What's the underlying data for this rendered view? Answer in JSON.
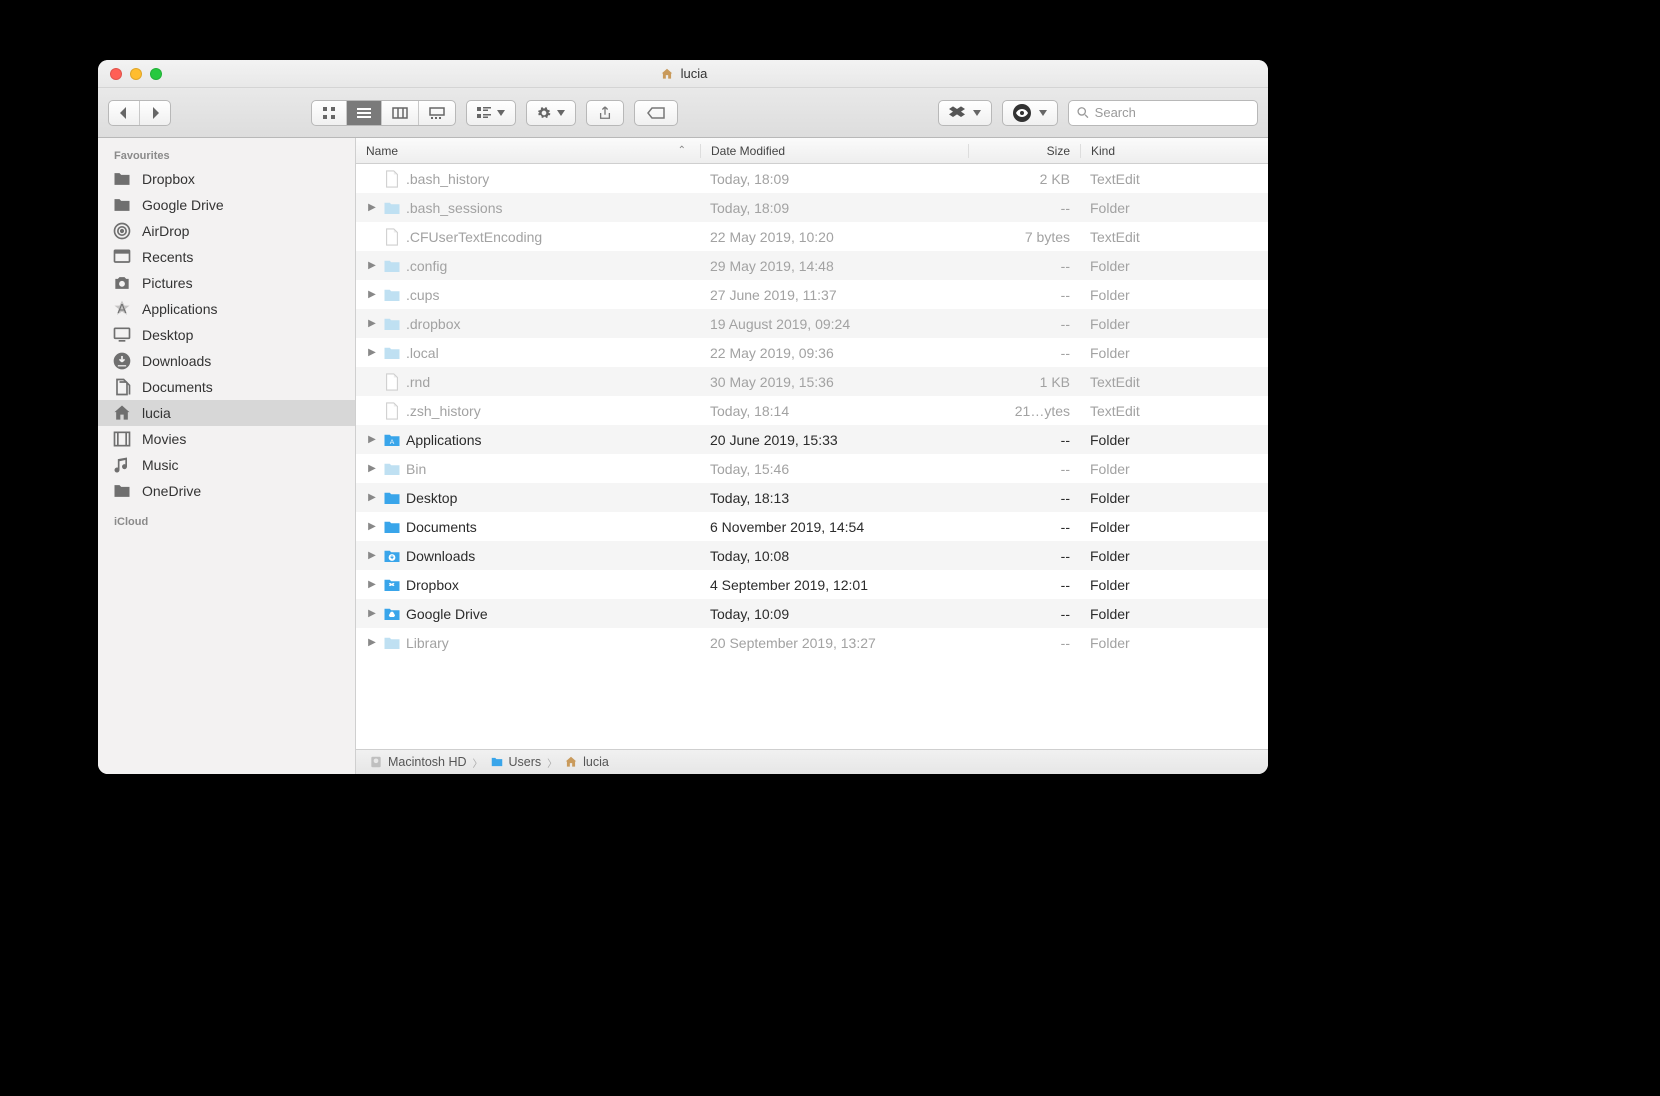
{
  "window": {
    "title": "lucia"
  },
  "toolbar": {
    "search_placeholder": "Search"
  },
  "sidebar": {
    "heading_favourites": "Favourites",
    "heading_icloud": "iCloud",
    "items": [
      {
        "label": "Dropbox",
        "icon": "folder"
      },
      {
        "label": "Google Drive",
        "icon": "folder"
      },
      {
        "label": "AirDrop",
        "icon": "airdrop"
      },
      {
        "label": "Recents",
        "icon": "recents"
      },
      {
        "label": "Pictures",
        "icon": "camera"
      },
      {
        "label": "Applications",
        "icon": "apps"
      },
      {
        "label": "Desktop",
        "icon": "desktop"
      },
      {
        "label": "Downloads",
        "icon": "download"
      },
      {
        "label": "Documents",
        "icon": "documents"
      },
      {
        "label": "lucia",
        "icon": "home",
        "selected": true
      },
      {
        "label": "Movies",
        "icon": "movies"
      },
      {
        "label": "Music",
        "icon": "music"
      },
      {
        "label": "OneDrive",
        "icon": "folder"
      }
    ]
  },
  "columns": {
    "name": "Name",
    "date": "Date Modified",
    "size": "Size",
    "kind": "Kind"
  },
  "rows": [
    {
      "name": ".bash_history",
      "date": "Today, 18:09",
      "size": "2 KB",
      "kind": "TextEdit",
      "type": "file",
      "dim": true
    },
    {
      "name": ".bash_sessions",
      "date": "Today, 18:09",
      "size": "--",
      "kind": "Folder",
      "type": "folder",
      "dim": true
    },
    {
      "name": ".CFUserTextEncoding",
      "date": "22 May 2019, 10:20",
      "size": "7 bytes",
      "kind": "TextEdit",
      "type": "file",
      "dim": true
    },
    {
      "name": ".config",
      "date": "29 May 2019, 14:48",
      "size": "--",
      "kind": "Folder",
      "type": "folder",
      "dim": true
    },
    {
      "name": ".cups",
      "date": "27 June 2019, 11:37",
      "size": "--",
      "kind": "Folder",
      "type": "folder",
      "dim": true
    },
    {
      "name": ".dropbox",
      "date": "19 August 2019, 09:24",
      "size": "--",
      "kind": "Folder",
      "type": "folder",
      "dim": true
    },
    {
      "name": ".local",
      "date": "22 May 2019, 09:36",
      "size": "--",
      "kind": "Folder",
      "type": "folder",
      "dim": true
    },
    {
      "name": ".rnd",
      "date": "30 May 2019, 15:36",
      "size": "1 KB",
      "kind": "TextEdit",
      "type": "file",
      "dim": true
    },
    {
      "name": ".zsh_history",
      "date": "Today, 18:14",
      "size": "21…ytes",
      "kind": "TextEdit",
      "type": "file",
      "dim": true
    },
    {
      "name": "Applications",
      "date": "20 June 2019, 15:33",
      "size": "--",
      "kind": "Folder",
      "type": "folder",
      "icon": "apps"
    },
    {
      "name": "Bin",
      "date": "Today, 15:46",
      "size": "--",
      "kind": "Folder",
      "type": "folder",
      "dim": true
    },
    {
      "name": "Desktop",
      "date": "Today, 18:13",
      "size": "--",
      "kind": "Folder",
      "type": "folder"
    },
    {
      "name": "Documents",
      "date": "6 November 2019, 14:54",
      "size": "--",
      "kind": "Folder",
      "type": "folder"
    },
    {
      "name": "Downloads",
      "date": "Today, 10:08",
      "size": "--",
      "kind": "Folder",
      "type": "folder",
      "icon": "download"
    },
    {
      "name": "Dropbox",
      "date": "4 September 2019, 12:01",
      "size": "--",
      "kind": "Folder",
      "type": "folder",
      "icon": "dropbox"
    },
    {
      "name": "Google Drive",
      "date": "Today, 10:09",
      "size": "--",
      "kind": "Folder",
      "type": "folder",
      "icon": "gdrive"
    },
    {
      "name": "Library",
      "date": "20 September 2019, 13:27",
      "size": "--",
      "kind": "Folder",
      "type": "folder",
      "dim": true
    }
  ],
  "path": [
    {
      "label": "Macintosh HD",
      "icon": "disk"
    },
    {
      "label": "Users",
      "icon": "folder"
    },
    {
      "label": "lucia",
      "icon": "home"
    }
  ]
}
